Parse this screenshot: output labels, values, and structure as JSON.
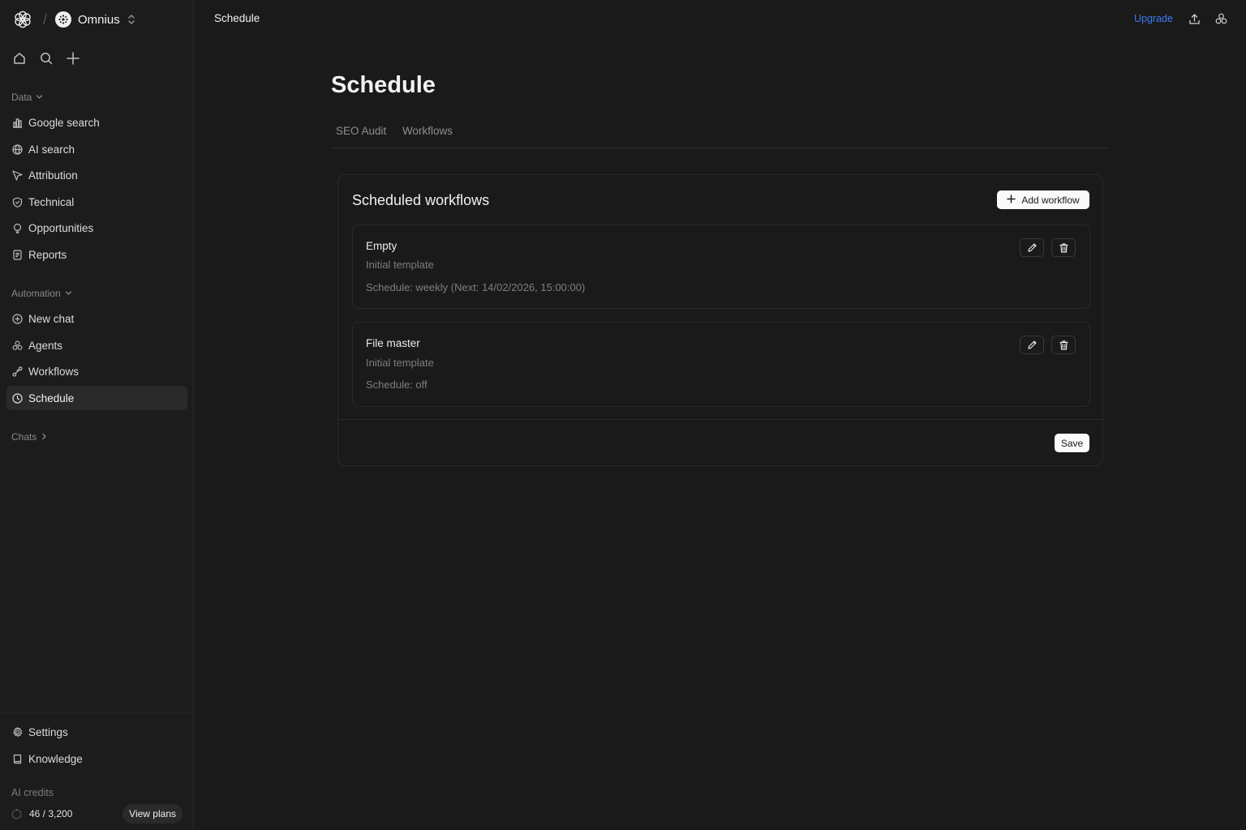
{
  "workspace": {
    "name": "Omnius"
  },
  "sidebar": {
    "data_section": {
      "label": "Data"
    },
    "data_items": [
      {
        "label": "Google search",
        "icon": "bar-chart-icon"
      },
      {
        "label": "AI search",
        "icon": "globe-icon"
      },
      {
        "label": "Attribution",
        "icon": "pointer-icon"
      },
      {
        "label": "Technical",
        "icon": "shield-icon"
      },
      {
        "label": "Opportunities",
        "icon": "lightbulb-icon"
      },
      {
        "label": "Reports",
        "icon": "file-icon"
      }
    ],
    "automation_section": {
      "label": "Automation"
    },
    "automation_items": [
      {
        "label": "New chat",
        "icon": "plus-circle-icon"
      },
      {
        "label": "Agents",
        "icon": "agents-icon"
      },
      {
        "label": "Workflows",
        "icon": "workflow-icon"
      },
      {
        "label": "Schedule",
        "icon": "clock-icon",
        "active": true
      }
    ],
    "chats_section": {
      "label": "Chats"
    },
    "bottom_items": [
      {
        "label": "Settings",
        "icon": "gear-icon"
      },
      {
        "label": "Knowledge",
        "icon": "book-icon"
      }
    ],
    "credits": {
      "label": "AI credits",
      "value": "46 / 3,200",
      "used_fraction": 0.014,
      "button": "View plans"
    }
  },
  "header": {
    "breadcrumb": "Schedule",
    "upgrade": "Upgrade"
  },
  "main": {
    "title": "Schedule",
    "tabs": [
      {
        "label": "SEO Audit"
      },
      {
        "label": "Workflows"
      }
    ],
    "card": {
      "title": "Scheduled workflows",
      "add_button": "Add workflow",
      "workflows": [
        {
          "name": "Empty",
          "template": "Initial template",
          "schedule": "Schedule: weekly (Next: 14/02/2026, 15:00:00)"
        },
        {
          "name": "File master",
          "template": "Initial template",
          "schedule": "Schedule: off"
        }
      ],
      "save_button": "Save"
    }
  },
  "colors": {
    "background": "#1a1a1a",
    "accent": "#3d7bf7",
    "text": "#e8e8e8",
    "muted": "#7e7e7e"
  }
}
